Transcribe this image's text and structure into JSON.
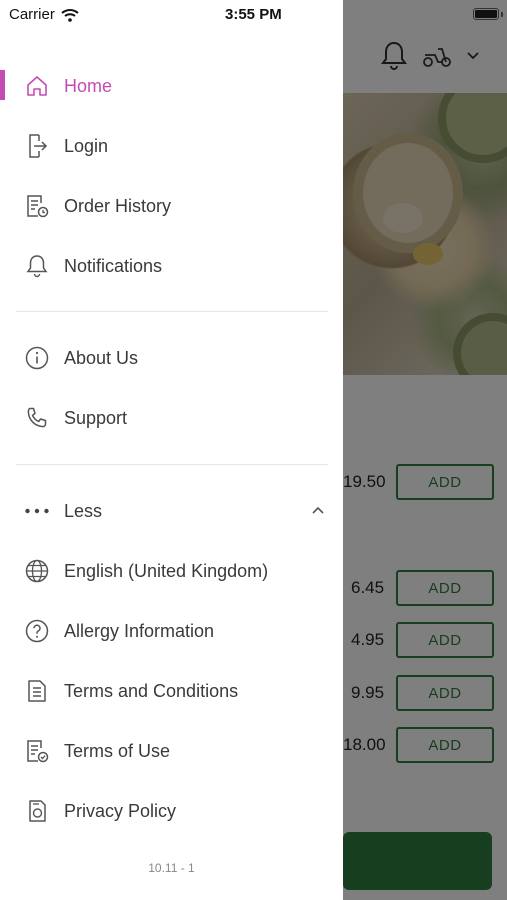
{
  "status_bar": {
    "carrier": "Carrier",
    "time": "3:55 PM"
  },
  "background": {
    "prices": [
      "19.50",
      "6.45",
      "4.95",
      "9.95",
      "18.00"
    ],
    "add_label": "ADD",
    "accent_color": "#2f7d3e"
  },
  "drawer": {
    "accent_color": "#c44bb4",
    "primary_items": [
      {
        "label": "Home",
        "icon": "home-icon",
        "active": true
      },
      {
        "label": "Login",
        "icon": "login-icon"
      },
      {
        "label": "Order History",
        "icon": "order-history-icon"
      },
      {
        "label": "Notifications",
        "icon": "bell-icon"
      }
    ],
    "secondary_items": [
      {
        "label": "About Us",
        "icon": "info-icon"
      },
      {
        "label": "Support",
        "icon": "phone-icon"
      }
    ],
    "more_toggle": {
      "label": "Less",
      "icon": "more-dots-icon"
    },
    "extra_items": [
      {
        "label": "English (United Kingdom)",
        "icon": "globe-icon"
      },
      {
        "label": "Allergy Information",
        "icon": "question-circle-icon"
      },
      {
        "label": "Terms and Conditions",
        "icon": "document-icon"
      },
      {
        "label": "Terms of Use",
        "icon": "document-check-icon"
      },
      {
        "label": "Privacy Policy",
        "icon": "privacy-icon"
      }
    ],
    "version": "10.11 - 1"
  }
}
